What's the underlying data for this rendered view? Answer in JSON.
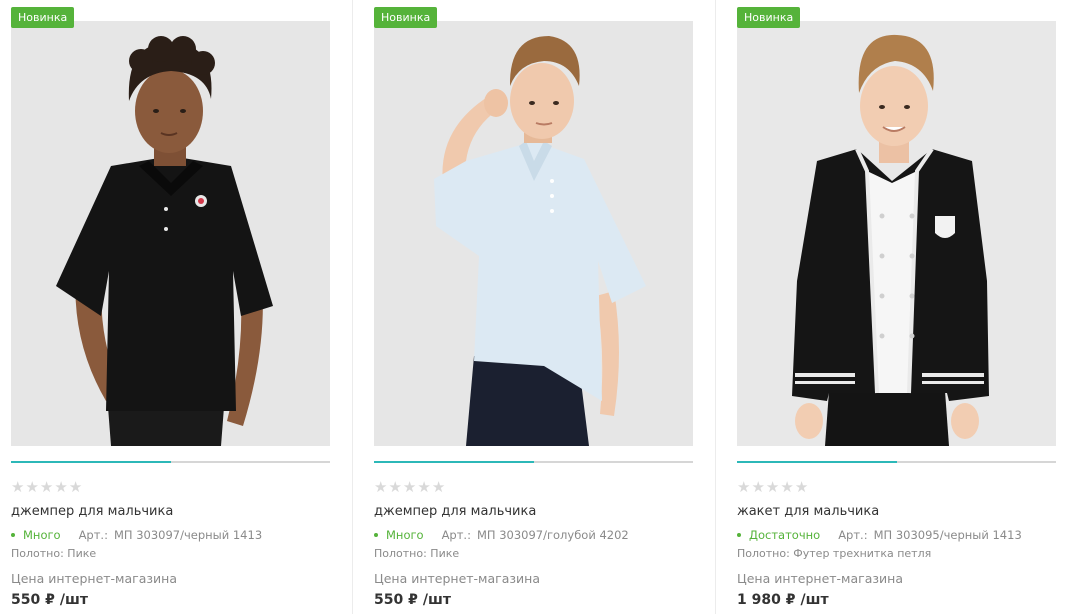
{
  "products": [
    {
      "badge": "Новинка",
      "rating": 0,
      "progress": 0.5,
      "name": "джемпер для мальчика",
      "stock": "Много",
      "article_label": "Арт.:",
      "article": "МП 303097/черный 1413",
      "fabric": "Полотно: Пике",
      "price_label": "Цена интернет-магазина",
      "price": "550 ₽",
      "unit": "/шт",
      "image": {
        "garment": "black-polo",
        "skin": "#8a5a3c",
        "hair": "#2a1e17"
      }
    },
    {
      "badge": "Новинка",
      "rating": 0,
      "progress": 0.5,
      "name": "джемпер для мальчика",
      "stock": "Много",
      "article_label": "Арт.:",
      "article": "МП 303097/голубой 4202",
      "fabric": "Полотно: Пике",
      "price_label": "Цена интернет-магазина",
      "price": "550 ₽",
      "unit": "/шт",
      "image": {
        "garment": "light-blue-polo",
        "skin": "#f0c9ad",
        "hair": "#9a6a3e"
      }
    },
    {
      "badge": "Новинка",
      "rating": 0,
      "progress": 0.5,
      "name": "жакет для мальчика",
      "stock": "Достаточно",
      "article_label": "Арт.:",
      "article": "МП 303095/черный 1413",
      "fabric": "Полотно: Футер трехнитка петля",
      "price_label": "Цена интернет-магазина",
      "price": "1 980 ₽",
      "unit": "/шт",
      "image": {
        "garment": "black-bomber",
        "skin": "#f2cdb2",
        "hair": "#b07f4c"
      }
    }
  ],
  "colors": {
    "badge": "#55b33a",
    "stock": "#55b33a",
    "progress": "#2cb8b8",
    "star_empty": "#d9d9d9",
    "photo_bg": "#e8e8e8"
  }
}
